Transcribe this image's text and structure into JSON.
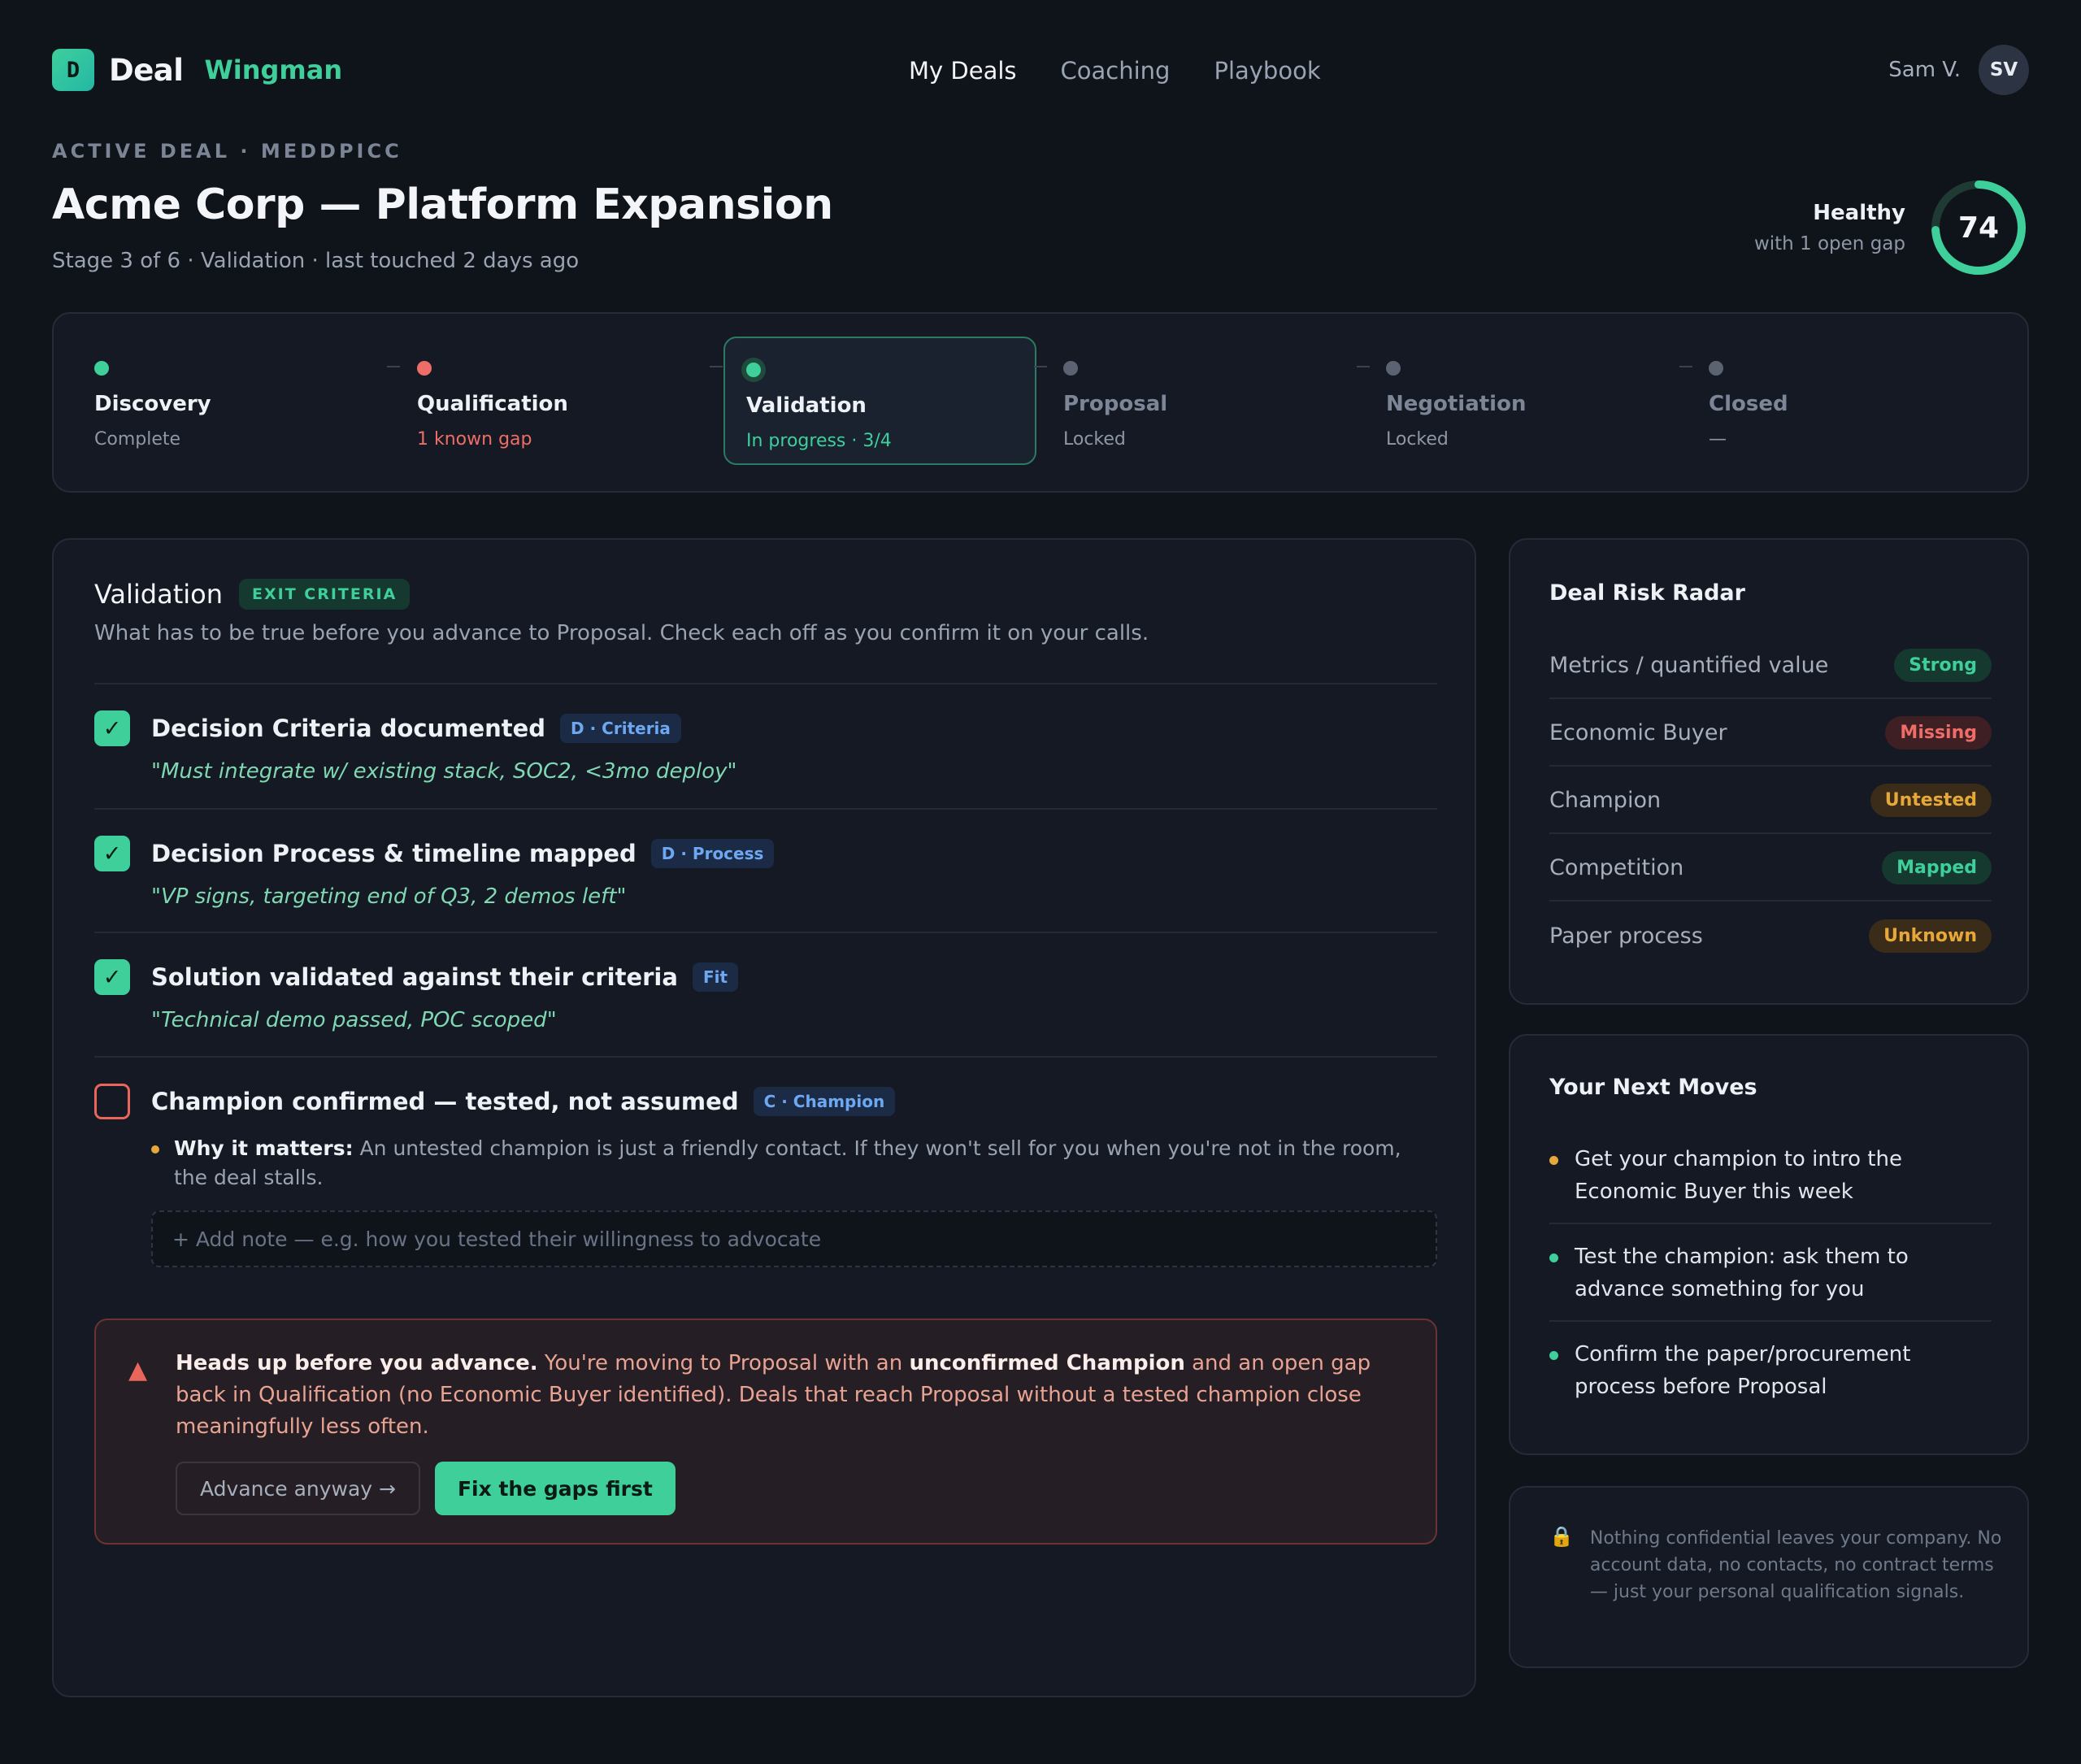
{
  "app": {
    "logo_mark": "D",
    "name_a": "Deal",
    "name_b": "Wingman"
  },
  "nav": {
    "items": [
      "My Deals",
      "Coaching",
      "Playbook"
    ],
    "active": "My Deals"
  },
  "user": {
    "name": "Sam V.",
    "initials": "SV"
  },
  "deal": {
    "eyebrow": "ACTIVE DEAL · MEDDPICC",
    "title": "Acme Corp — Platform Expansion",
    "subtitle": "Stage 3 of 6 · Validation · last touched 2 days ago",
    "health_label": "Healthy",
    "health_sub": "with 1 open gap",
    "health_score": "74",
    "health_value": 74,
    "health_max": 100
  },
  "stages": [
    {
      "name": "Discovery",
      "status": "Complete",
      "dot": "#3ecf9b",
      "status_color": "#8e97a6"
    },
    {
      "name": "Qualification",
      "status": "1 known gap",
      "dot": "#ee6d66",
      "status_color": "#ee6d66"
    },
    {
      "name": "Validation",
      "status": "In progress · 3/4",
      "dot": "#3ecf9b",
      "status_color": "#3ecf9b"
    },
    {
      "name": "Proposal",
      "status": "Locked",
      "dot": "#5b6373",
      "status_color": "#8e97a6"
    },
    {
      "name": "Negotiation",
      "status": "Locked",
      "dot": "#5b6373",
      "status_color": "#8e97a6"
    },
    {
      "name": "Closed",
      "status": "—",
      "dot": "#5b6373",
      "status_color": "#8e97a6"
    }
  ],
  "validation": {
    "title": "Validation",
    "pill": "EXIT CRITERIA",
    "description": "What has to be true before you advance to Proposal. Check each off as you confirm it on your calls.",
    "criteria": [
      {
        "title": "Decision Criteria documented",
        "tag": "D · Criteria",
        "quote": "\"Must integrate w/ existing stack, SOC2, <3mo deploy\"",
        "checked": true
      },
      {
        "title": "Decision Process & timeline mapped",
        "tag": "D · Process",
        "quote": "\"VP signs, targeting end of Q3, 2 demos left\"",
        "checked": true
      },
      {
        "title": "Solution validated against their criteria",
        "tag": "Fit",
        "quote": "\"Technical demo passed, POC scoped\"",
        "checked": true
      },
      {
        "title": "Champion confirmed — tested, not assumed",
        "tag": "C · Champion",
        "checked": false
      }
    ],
    "check_glyph": "✓",
    "why_label": "Why it matters:",
    "why_text": "An untested champion is just a friendly contact. If they won't sell for you when you're not in the room, the deal stalls.",
    "note_placeholder": "+ Add note — e.g. how you tested their willingness to advocate"
  },
  "alert": {
    "icon": "▲",
    "strong": "Heads up before you advance.",
    "text_1": "You're moving to Proposal with an",
    "strong_2": "unconfirmed Champion",
    "text_2": "and an open gap back in Qualification (no Economic Buyer identified). Deals that reach Proposal without a tested champion close meaningfully less often.",
    "advance_label": "Advance anyway →",
    "fix_label": "Fix the gaps first"
  },
  "risk_radar": {
    "title": "Deal Risk Radar",
    "rows": [
      {
        "label": "Metrics / quantified value",
        "badge": "Strong",
        "kind": "strong"
      },
      {
        "label": "Economic Buyer",
        "badge": "Missing",
        "kind": "missing"
      },
      {
        "label": "Champion",
        "badge": "Untested",
        "kind": "untested"
      },
      {
        "label": "Competition",
        "badge": "Mapped",
        "kind": "strong"
      },
      {
        "label": "Paper process",
        "badge": "Unknown",
        "kind": "untested"
      }
    ]
  },
  "next_moves": {
    "title": "Your Next Moves",
    "items": [
      {
        "text": "Get your champion to intro the Economic Buyer this week",
        "dot": "#e7a83a"
      },
      {
        "text": "Test the champion: ask them to advance something for you",
        "dot": "#3ecf9b"
      },
      {
        "text": "Confirm the paper/procurement process before Proposal",
        "dot": "#3ecf9b"
      }
    ]
  },
  "privacy": {
    "icon": "lock-icon",
    "text": "Nothing confidential leaves your company. No account data, no contacts, no contract terms — just your personal qualification signals."
  },
  "colors": {
    "accent": "#3ecf9b",
    "danger": "#ee6d66",
    "warning": "#e7a83a",
    "background": "#0f131a",
    "card": "#141923"
  }
}
